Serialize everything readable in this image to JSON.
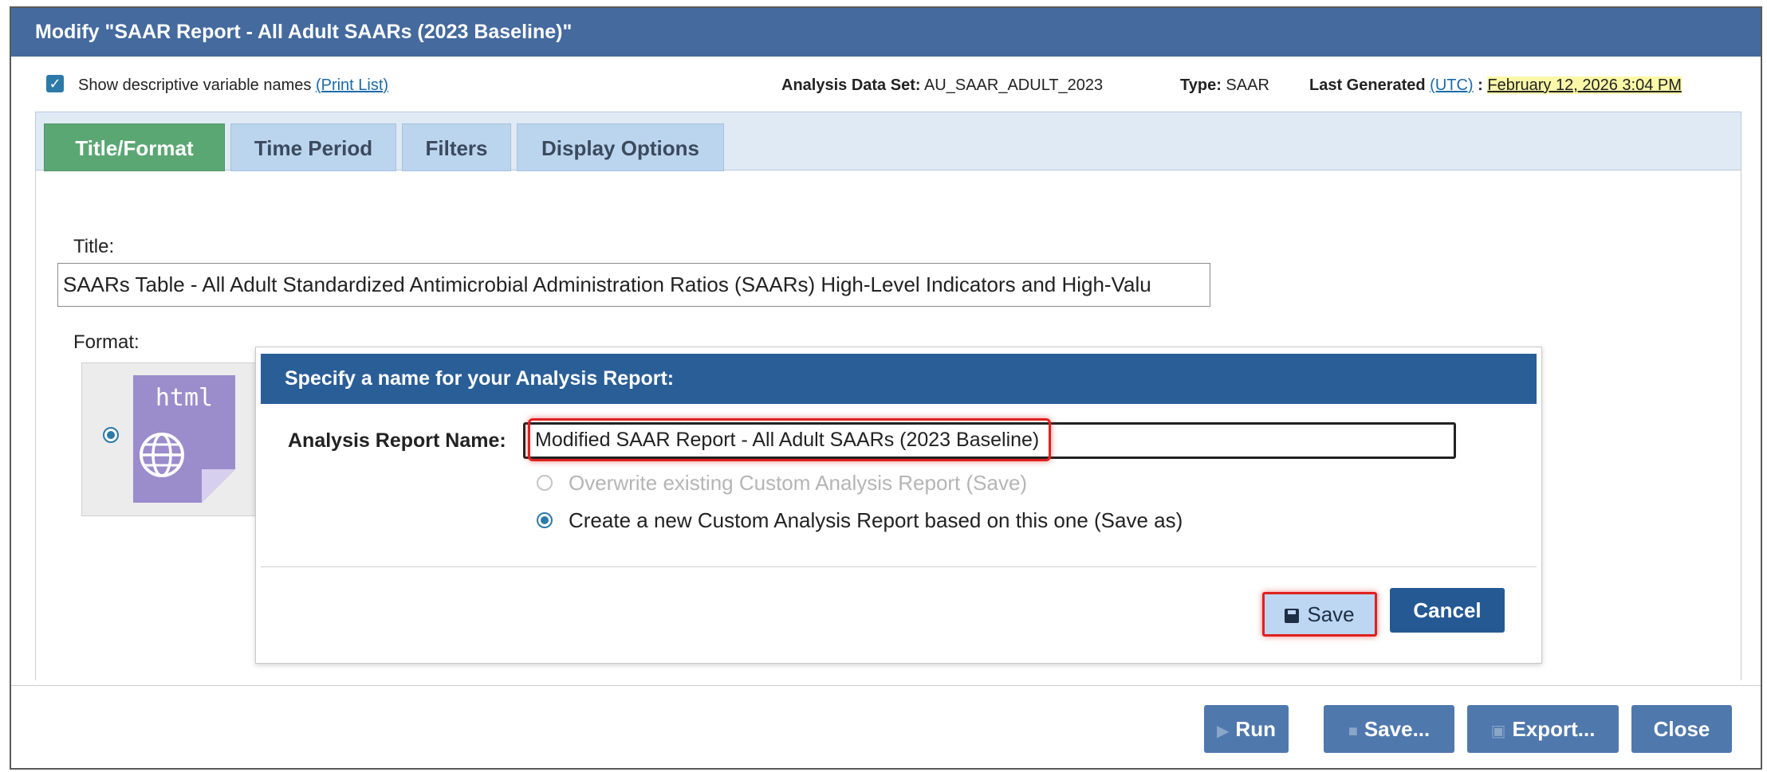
{
  "window": {
    "title": "Modify \"SAAR Report - All Adult SAARs (2023 Baseline)\""
  },
  "infobar": {
    "show_names_label": "Show descriptive variable names",
    "print_list_link": "(Print List)",
    "dataset_label": "Analysis Data Set:",
    "dataset_value": "AU_SAAR_ADULT_2023",
    "type_label": "Type:",
    "type_value": "SAAR",
    "generated_label": "Last Generated",
    "utc_link": "(UTC)",
    "colon": ":",
    "generated_value": "February 12, 2026 3:04 PM"
  },
  "tabs": [
    {
      "label": "Title/Format",
      "active": true
    },
    {
      "label": "Time Period",
      "active": false
    },
    {
      "label": "Filters",
      "active": false
    },
    {
      "label": "Display Options",
      "active": false
    }
  ],
  "form": {
    "title_label": "Title:",
    "title_value": "SAARs Table - All Adult Standardized Antimicrobial Administration Ratios (SAARs) High-Level Indicators and High-Valu",
    "format_label": "Format:",
    "format_option": "html"
  },
  "dialog": {
    "header": "Specify a name for your Analysis Report:",
    "name_label": "Analysis Report Name:",
    "name_value": "Modified SAAR Report - All Adult SAARs (2023 Baseline)",
    "option_overwrite": "Overwrite existing Custom Analysis Report (Save)",
    "option_save_as": "Create a new Custom Analysis Report based on this one (Save as)",
    "save_label": "Save",
    "cancel_label": "Cancel"
  },
  "footer": {
    "run_label": "Run",
    "save_label": "Save...",
    "export_label": "Export...",
    "close_label": "Close"
  },
  "colors": {
    "titlebar": "#446a9e",
    "active_tab": "#5ba774",
    "dialog_header": "#2a5e97",
    "highlight": "#e02020"
  }
}
